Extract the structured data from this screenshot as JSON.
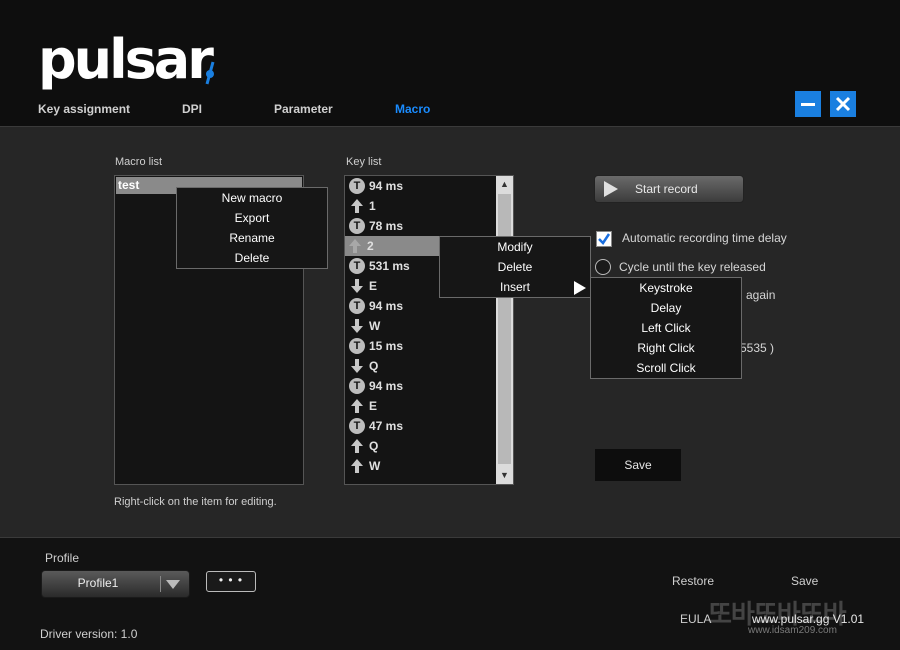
{
  "header": {
    "logo_text": "pulsar",
    "tabs": [
      {
        "label": "Key assignment",
        "active": false
      },
      {
        "label": "DPI",
        "active": false
      },
      {
        "label": "Parameter",
        "active": false
      },
      {
        "label": "Macro",
        "active": true
      }
    ],
    "accent_color": "#1a8cff"
  },
  "macro_list": {
    "label": "Macro list",
    "items": [
      "test"
    ],
    "hint": "Right-click on the item for editing.",
    "context_menu": [
      "New macro",
      "Export",
      "Rename",
      "Delete"
    ]
  },
  "key_list": {
    "label": "Key list",
    "items": [
      {
        "icon": "timer-icon",
        "text": "94 ms"
      },
      {
        "icon": "arrow-up-icon",
        "text": "1"
      },
      {
        "icon": "timer-icon",
        "text": "78 ms"
      },
      {
        "icon": "arrow-up-icon",
        "text": "2",
        "selected": true
      },
      {
        "icon": "timer-icon",
        "text": "531 ms"
      },
      {
        "icon": "arrow-down-icon",
        "text": "E"
      },
      {
        "icon": "timer-icon",
        "text": "94 ms"
      },
      {
        "icon": "arrow-down-icon",
        "text": "W"
      },
      {
        "icon": "timer-icon",
        "text": "15 ms"
      },
      {
        "icon": "arrow-down-icon",
        "text": "Q"
      },
      {
        "icon": "timer-icon",
        "text": "94 ms"
      },
      {
        "icon": "arrow-up-icon",
        "text": "E"
      },
      {
        "icon": "timer-icon",
        "text": "47 ms"
      },
      {
        "icon": "arrow-up-icon",
        "text": "Q"
      },
      {
        "icon": "arrow-up-icon",
        "text": "W"
      }
    ],
    "timer_glyph": "T",
    "context_menu": [
      "Modify",
      "Delete",
      "Insert"
    ],
    "insert_submenu": [
      "Keystroke",
      "Delay",
      "Left Click",
      "Right Click",
      "Scroll Click"
    ]
  },
  "controls": {
    "start_record_label": "Start record",
    "auto_delay_label": "Automatic recording time delay",
    "auto_delay_checked": true,
    "cycle_label": "Cycle until the key released",
    "partial_option_text": "d again",
    "partial_range_text": "5535 )",
    "save_label": "Save"
  },
  "footer": {
    "profile_label": "Profile",
    "profile_value": "Profile1",
    "more_label": "• • •",
    "driver_version": "Driver version:  1.0",
    "restore_label": "Restore",
    "save_label": "Save",
    "eula_label": "EULA",
    "website": "www.pulsar.gg   V1.01",
    "watermark": "또바또바또바",
    "watermark_url": "www.idsam209.com"
  }
}
